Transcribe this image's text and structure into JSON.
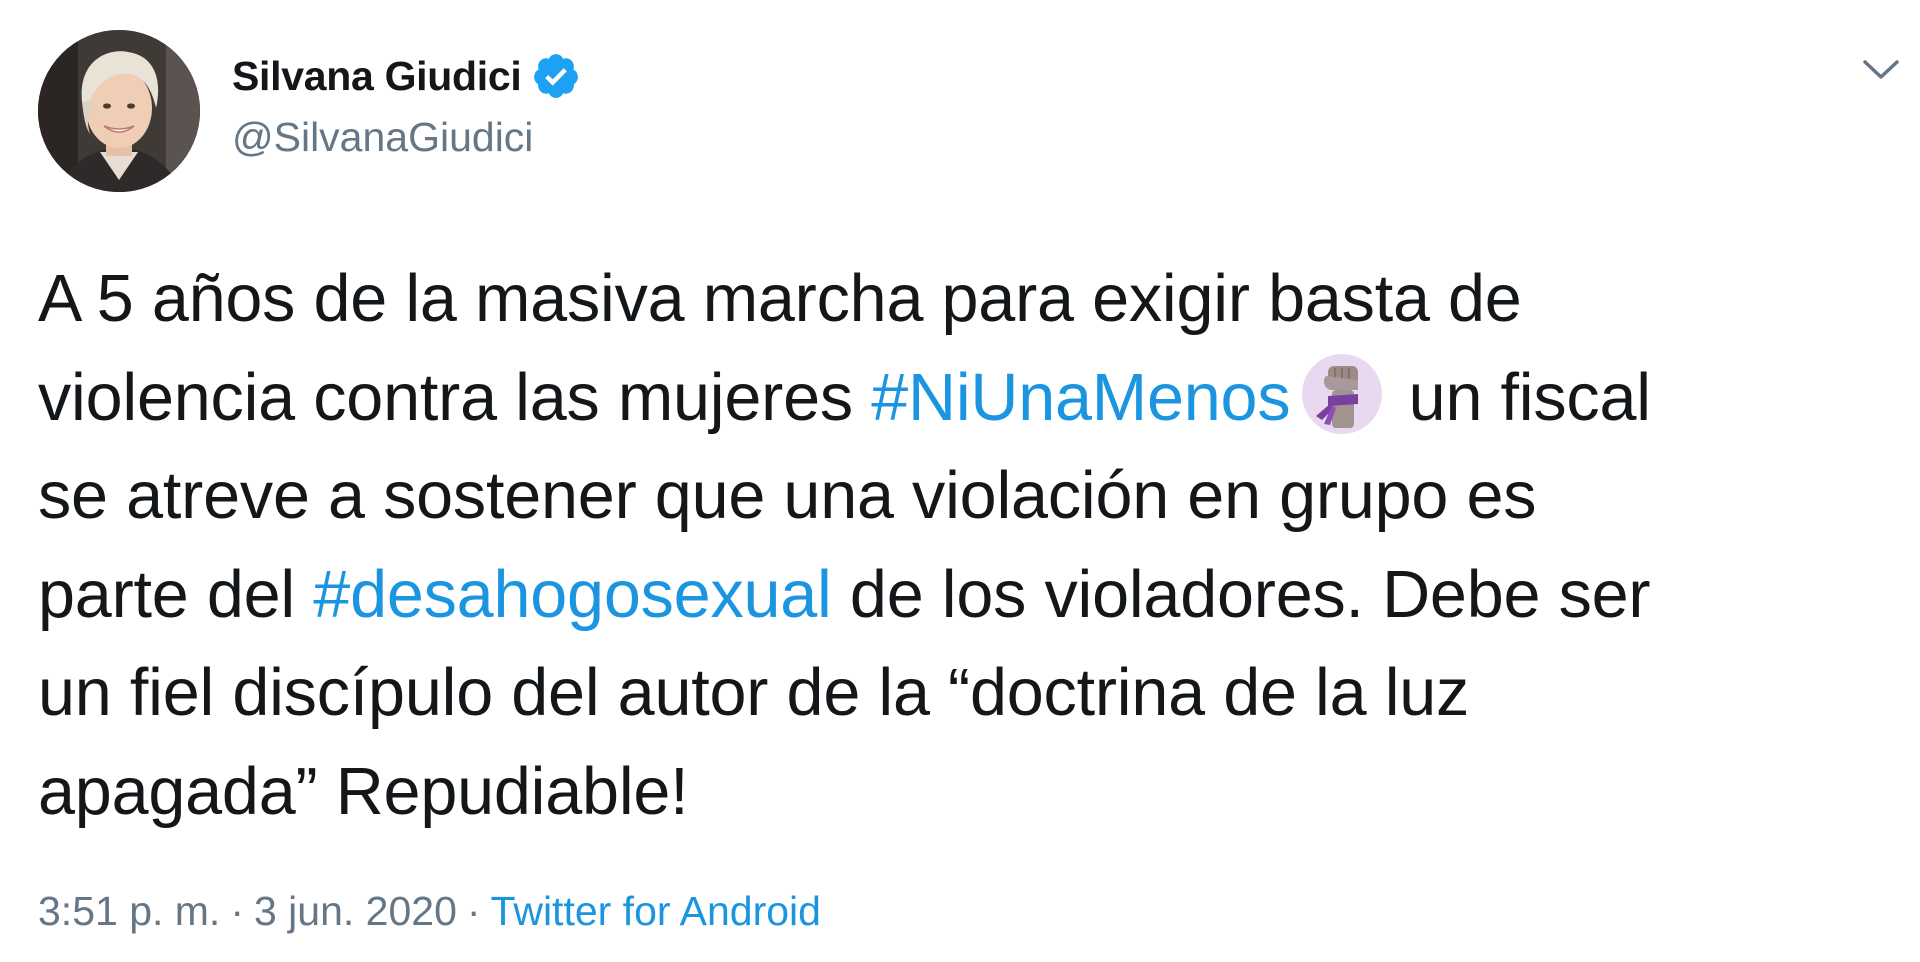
{
  "author": {
    "name": "Silvana Giudici",
    "handle": "@SilvanaGiudici",
    "verified": true
  },
  "tweet": {
    "lines": [
      [
        "A 5 años de la masiva marcha para exigir basta de"
      ],
      [
        "violencia contra las mujeres ",
        "#NiUnaMenos",
        " un fiscal"
      ],
      [
        "se atreve a sostener que una violación en grupo es"
      ],
      [
        "parte del ",
        "#desahogosexual",
        " de los violadores. Debe ser"
      ],
      [
        "un fiel discípulo del autor de la “doctrina de la luz"
      ],
      [
        "apagada” Repudiable!"
      ]
    ],
    "hashtags": [
      "#NiUnaMenos",
      "#desahogosexual"
    ],
    "emoji": "raised-fist-with-purple-scarf-icon"
  },
  "meta": {
    "time": "3:51 p. m.",
    "separator": "·",
    "date": "3 jun. 2020",
    "source": "Twitter for Android"
  },
  "colors": {
    "text": "#14171a",
    "secondary": "#657786",
    "link": "#1b95e0",
    "verified": "#1da1f2",
    "emoji_bg": "#e8d9f0",
    "emoji_scarf": "#7b3fa0"
  }
}
